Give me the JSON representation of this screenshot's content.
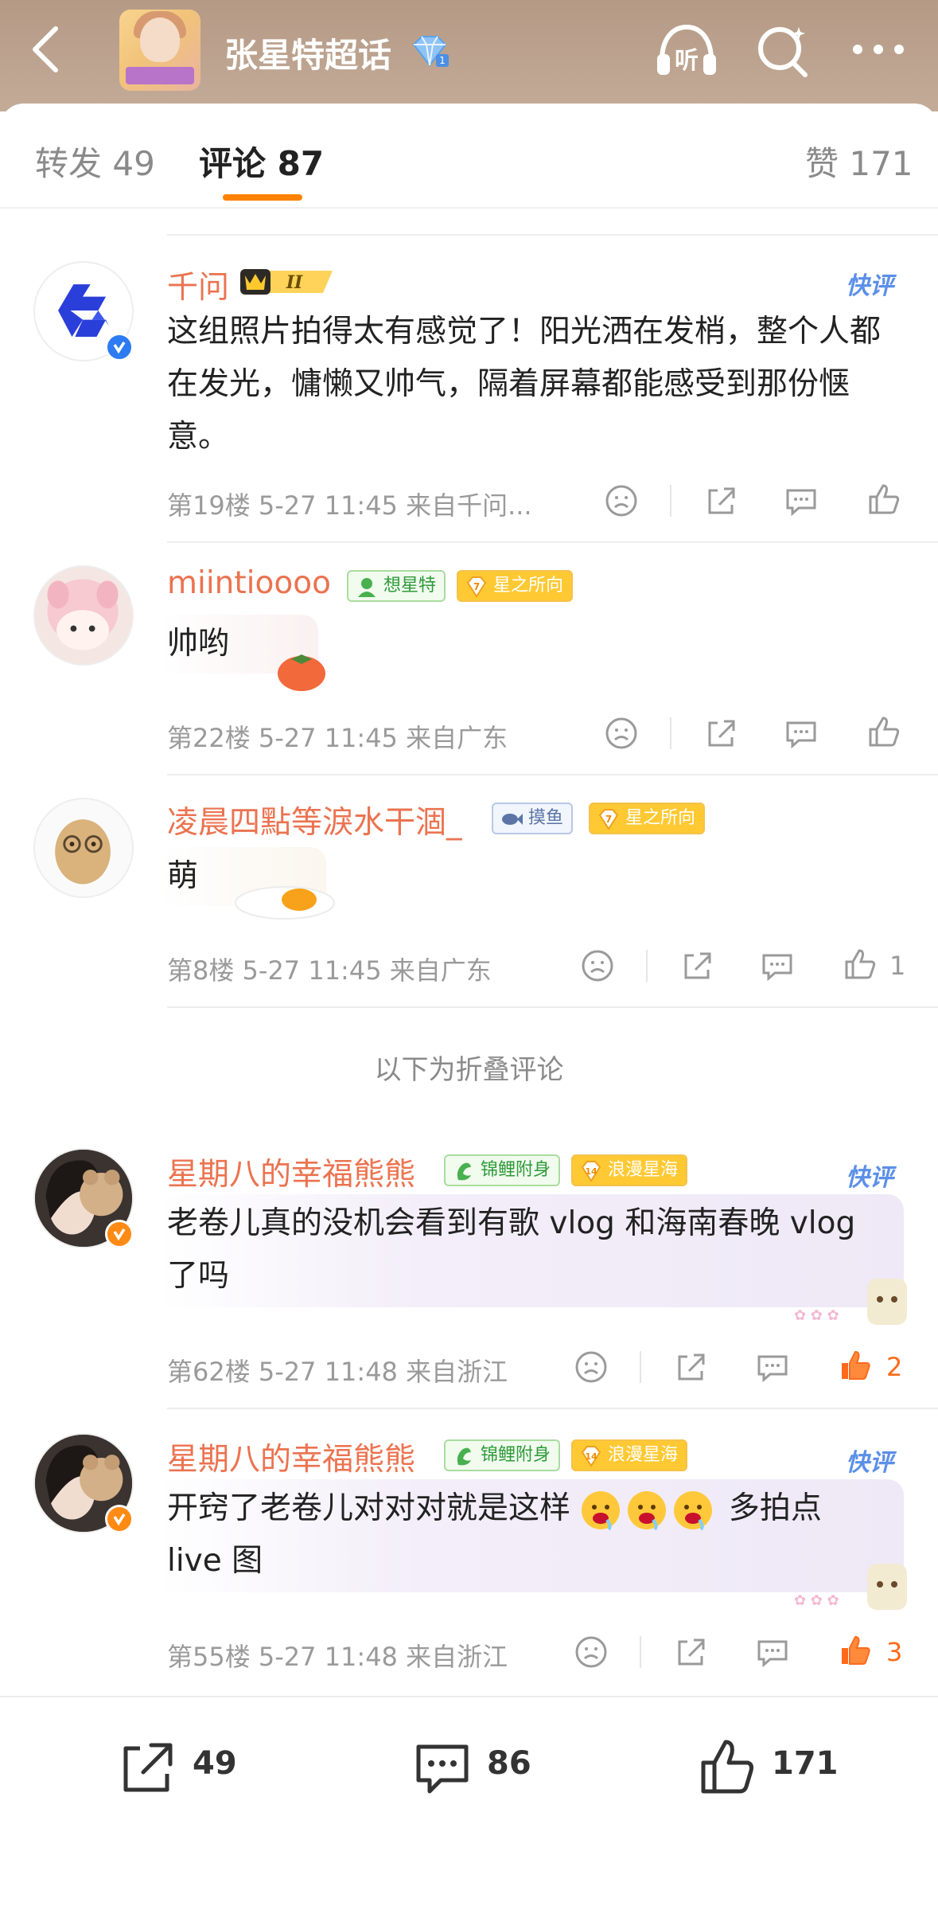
{
  "header": {
    "topic_title": "张星特超话",
    "listen_label": "听"
  },
  "tabs": [
    {
      "label": "转发 49"
    },
    {
      "label": "评论 87"
    },
    {
      "label": "赞 171"
    }
  ],
  "comments": [
    {
      "username": "千问",
      "crown_level": "II",
      "kuaiping": "快评",
      "text": "这组照片拍得太有感觉了！阳光洒在发梢，整个人都在发光，慵懒又帅气，隔着屏幕都能感受到那份惬意。",
      "meta": "第19楼 5-27 11:45 来自千问...",
      "likes": ""
    },
    {
      "username": "miintioooo",
      "badges": [
        {
          "label": "想星特"
        },
        {
          "label": "星之所向",
          "level": "7"
        }
      ],
      "text": "帅哟",
      "meta": "第22楼 5-27 11:45 来自广东",
      "likes": ""
    },
    {
      "username": "凌晨四點等淚水干涸_",
      "badges": [
        {
          "label": "摸鱼"
        },
        {
          "label": "星之所向",
          "level": "7"
        }
      ],
      "text": "萌",
      "meta": "第8楼 5-27 11:45 来自广东",
      "likes": "1"
    },
    {
      "username": "星期八的幸福熊熊",
      "badges": [
        {
          "label": "锦鲤附身"
        },
        {
          "label": "浪漫星海",
          "level": "14"
        }
      ],
      "kuaiping": "快评",
      "text": "老卷儿真的没机会看到有歌 vlog 和海南春晚 vlog 了吗",
      "meta": "第62楼 5-27 11:48 来自浙江",
      "likes": "2"
    },
    {
      "username": "星期八的幸福熊熊",
      "badges": [
        {
          "label": "锦鲤附身"
        },
        {
          "label": "浪漫星海",
          "level": "14"
        }
      ],
      "kuaiping": "快评",
      "text_before": "开窍了老卷儿对对对就是这样",
      "text_after": "多拍点 live 图",
      "meta": "第55楼 5-27 11:48 来自浙江",
      "likes": "3"
    }
  ],
  "folded_label": "以下为折叠评论",
  "bottom_bar": {
    "repost": "49",
    "comment": "86",
    "like": "171"
  },
  "colors": {
    "accent": "#ff8200",
    "username": "#eb7350",
    "kuaiping": "#5b8fe8",
    "hot_like": "#ff6a1a"
  }
}
